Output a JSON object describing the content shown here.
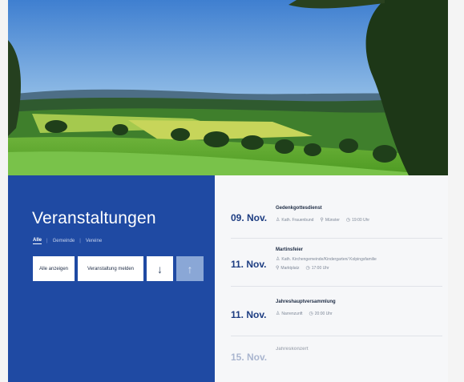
{
  "hero": {
    "scene": "landscape-photo"
  },
  "section": {
    "title": "Veranstaltungen",
    "filters": [
      "Alle",
      "Gemeinde",
      "Vereine"
    ],
    "active_filter": "Alle",
    "separator": "|"
  },
  "buttons": {
    "show_all": "Alle anzeigen",
    "report_event": "Veranstaltung melden",
    "down_glyph": "↓",
    "up_glyph": "↑"
  },
  "events": [
    {
      "date": "09. Nov.",
      "name": "Gedenkgottesdienst",
      "organizer": "Kath. Frauenbund",
      "location": "Münster",
      "time": "19:00 Uhr"
    },
    {
      "date": "11. Nov.",
      "name": "Martinsfeier",
      "organizer": "Kath. Kirchengemeinde/Kindergarten/ Kolpingsfamilie",
      "location": "Marktplatz",
      "time": "17:00 Uhr"
    },
    {
      "date": "11. Nov.",
      "name": "Jahreshauptversammlung",
      "organizer": "Narrenzunft",
      "time": "20:00 Uhr"
    },
    {
      "date": "15. Nov.",
      "name": "Jahreskonzert"
    }
  ],
  "colors": {
    "primary_blue": "#1f4aa3",
    "date_blue": "#1d3d82",
    "panel_gray": "#f6f7f9"
  }
}
